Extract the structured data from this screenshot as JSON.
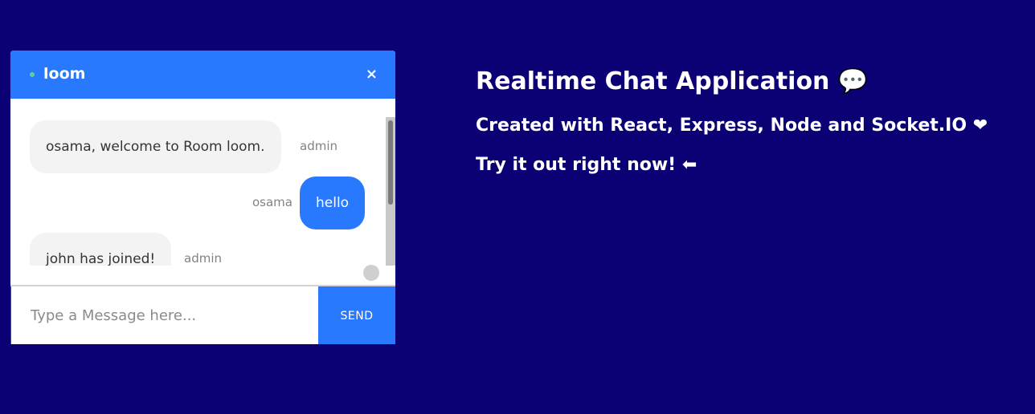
{
  "chat": {
    "room_name": "loom",
    "close_label": "×",
    "messages": [
      {
        "text": "osama, welcome to Room loom.",
        "sender": "admin",
        "mine": false
      },
      {
        "text": "hello",
        "sender": "osama",
        "mine": true
      },
      {
        "text": "john has joined!",
        "sender": "admin",
        "mine": false
      }
    ],
    "input": {
      "placeholder": "Type a Message here...",
      "value": ""
    },
    "send_label": "SEND"
  },
  "info": {
    "title": "Realtime Chat Application",
    "title_icon": "💬",
    "subtitle": "Created with React, Express, Node and Socket.IO",
    "subtitle_icon": "❤",
    "cta": "Try it out right now!",
    "cta_icon": "⬅"
  },
  "colors": {
    "background": "#0b0074",
    "accent": "#2979ff",
    "online": "#5ad0a0"
  }
}
